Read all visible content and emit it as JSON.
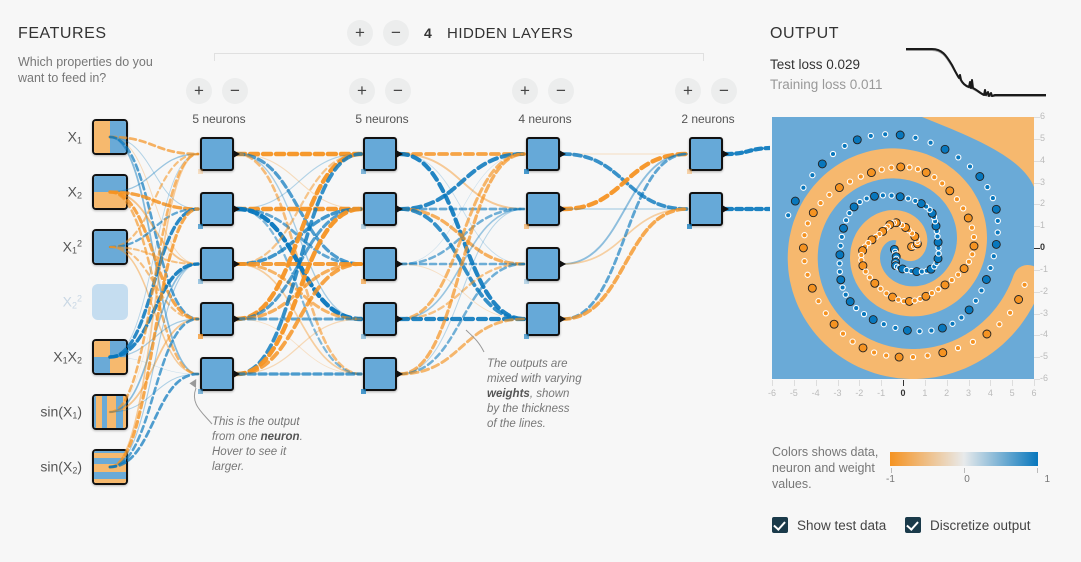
{
  "features": {
    "title": "FEATURES",
    "subtitle": "Which properties do you want to feed in?",
    "items": [
      {
        "label_html": "X1",
        "base": "X",
        "sub": "1",
        "sup": "",
        "pattern": "v-split",
        "enabled": true
      },
      {
        "label_html": "X2",
        "base": "X",
        "sub": "2",
        "sup": "",
        "pattern": "h-split",
        "enabled": true
      },
      {
        "label_html": "X1^2",
        "base": "X",
        "sub": "1",
        "sup": "2",
        "pattern": "solid-blue",
        "enabled": true
      },
      {
        "label_html": "X2^2",
        "base": "X",
        "sub": "2",
        "sup": "2",
        "pattern": "disabled",
        "enabled": false
      },
      {
        "label_html": "X1X2",
        "base": "X1X2",
        "sub": "",
        "sup": "",
        "pattern": "checker",
        "enabled": true
      },
      {
        "label_html": "sin(X1)",
        "base": "sin(X",
        "sub": "1",
        "sup": "",
        "pattern": "v-stripes",
        "enabled": true
      },
      {
        "label_html": "sin(X2)",
        "base": "sin(X",
        "sub": "2",
        "sup": "",
        "pattern": "h-stripes",
        "enabled": true
      }
    ]
  },
  "network": {
    "add_layer_label": "+",
    "remove_layer_label": "−",
    "hidden_layer_count": "4",
    "hidden_layers_label": "HIDDEN LAYERS",
    "layers": [
      {
        "neuron_count": 5,
        "label": "5 neurons"
      },
      {
        "neuron_count": 5,
        "label": "5 neurons"
      },
      {
        "neuron_count": 4,
        "label": "4 neurons"
      },
      {
        "neuron_count": 2,
        "label": "2 neurons"
      }
    ],
    "callout_neuron": "This is the output from one neuron. Hover to see it larger.",
    "callout_neuron_parts": {
      "p1": "This is the output",
      "p2": "from one ",
      "bold": "neuron",
      "p2b": ".",
      "p3": "Hover to see it",
      "p4": "larger."
    },
    "callout_weights_parts": {
      "p1": "The outputs are",
      "p2": "mixed with varying",
      "bold": "weights",
      "p2b": ", shown",
      "p3": "by the thickness",
      "p4": "of the lines."
    }
  },
  "output": {
    "title": "OUTPUT",
    "test_loss": "Test loss 0.029",
    "training_loss": "Training loss 0.011",
    "x_ticks": [
      "-6",
      "-5",
      "-4",
      "-3",
      "-2",
      "-1",
      "0",
      "1",
      "2",
      "3",
      "4",
      "5",
      "6"
    ],
    "y_ticks": [
      "6",
      "5",
      "4",
      "3",
      "2",
      "1",
      "0",
      "-1",
      "-2",
      "-3",
      "-4",
      "-5",
      "-6"
    ],
    "legend_text": "Colors shows data, neuron and weight values.",
    "gradient_labels": [
      "-1",
      "0",
      "1"
    ],
    "checkboxes": [
      {
        "label": "Show test data",
        "checked": true
      },
      {
        "label": "Discretize output",
        "checked": true
      }
    ]
  },
  "colors": {
    "orange": "#f59322",
    "blue": "#0877bd",
    "neuron_fill": "#66a9d8",
    "heat_blue": "#6aaad7",
    "heat_orange": "#f6b86e",
    "background": "#f7f7f7"
  },
  "chart_data": {
    "type": "scatter",
    "title": "OUTPUT",
    "dataset": "spiral",
    "xlabel": "",
    "ylabel": "",
    "xlim": [
      -6,
      6
    ],
    "ylim": [
      -6,
      6
    ],
    "grid": false,
    "legend": "Colors shows data, neuron and weight values.",
    "series": [
      {
        "name": "class +1 (orange)",
        "color": "#f59322",
        "count": 95
      },
      {
        "name": "class -1 (blue)",
        "color": "#0877bd",
        "count": 95
      }
    ],
    "annotations": [
      "Test loss 0.029",
      "Training loss 0.011"
    ],
    "loss_curve": {
      "type": "line",
      "series": [
        {
          "name": "test loss",
          "color": "#333"
        },
        {
          "name": "training loss",
          "color": "#999"
        }
      ],
      "shape": "flat plateau then steep decline then flat low"
    }
  }
}
